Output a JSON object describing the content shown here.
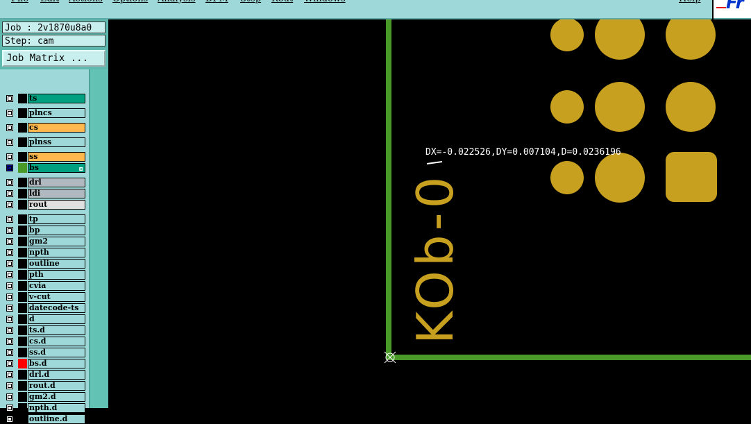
{
  "menubar": {
    "items": [
      "File",
      "Edit",
      "Actions",
      "Options",
      "Analysis",
      "DFM",
      "Step",
      "Rout",
      "Windows"
    ],
    "help": "Help",
    "logo": "Fr"
  },
  "job": {
    "job_line": "Job : 2v1870u8a0",
    "step_line": "Step: cam",
    "matrix_label": "Job Matrix ..."
  },
  "layers": [
    {
      "name": "ts",
      "color": "#00a080",
      "group": 0
    },
    {
      "name": "plncs",
      "color": "#9ed8d8",
      "group": 1
    },
    {
      "name": "cs",
      "color": "#ffb84d",
      "group": 2
    },
    {
      "name": "plnss",
      "color": "#9ed8d8",
      "group": 3
    },
    {
      "name": "ss",
      "color": "#ffb84d",
      "group": 4
    },
    {
      "name": "bs",
      "color": "#00a080",
      "group": 4,
      "active": true,
      "swatch": "#4a9a2a",
      "mark": "⊞"
    },
    {
      "name": "drl",
      "color": "#b0b8c0",
      "group": 5
    },
    {
      "name": "ldi",
      "color": "#b0b8c0",
      "group": 5
    },
    {
      "name": "rout",
      "color": "#e0e0e0",
      "group": 5
    },
    {
      "name": "tp",
      "color": "#9ed8d8",
      "group": 6
    },
    {
      "name": "bp",
      "color": "#9ed8d8",
      "group": 6
    },
    {
      "name": "gm2",
      "color": "#9ed8d8",
      "group": 6
    },
    {
      "name": "npth",
      "color": "#9ed8d8",
      "group": 6
    },
    {
      "name": "outline",
      "color": "#9ed8d8",
      "group": 6
    },
    {
      "name": "pth",
      "color": "#9ed8d8",
      "group": 6
    },
    {
      "name": "cvia",
      "color": "#9ed8d8",
      "group": 6
    },
    {
      "name": "v-cut",
      "color": "#9ed8d8",
      "group": 6
    },
    {
      "name": "datecode-ts",
      "color": "#9ed8d8",
      "group": 6
    },
    {
      "name": "d",
      "color": "#9ed8d8",
      "group": 6
    },
    {
      "name": "ts.d",
      "color": "#9ed8d8",
      "group": 6
    },
    {
      "name": "cs.d",
      "color": "#9ed8d8",
      "group": 6
    },
    {
      "name": "ss.d",
      "color": "#9ed8d8",
      "group": 6
    },
    {
      "name": "bs.d",
      "color": "#9ed8d8",
      "group": 6,
      "swatch": "#ff0000"
    },
    {
      "name": "drl.d",
      "color": "#9ed8d8",
      "group": 6
    },
    {
      "name": "rout.d",
      "color": "#9ed8d8",
      "group": 6
    },
    {
      "name": "gm2.d",
      "color": "#9ed8d8",
      "group": 6
    },
    {
      "name": "npth.d",
      "color": "#9ed8d8",
      "group": 6
    },
    {
      "name": "outline.d",
      "color": "#9ed8d8",
      "group": 6
    }
  ],
  "canvas": {
    "measure_text": "DX=-0.022526,DY=0.007104,D=0.0236196",
    "silk_text": "KOb-0",
    "pad_color": "#c8a020",
    "outline_color": "#4a9a2a"
  }
}
